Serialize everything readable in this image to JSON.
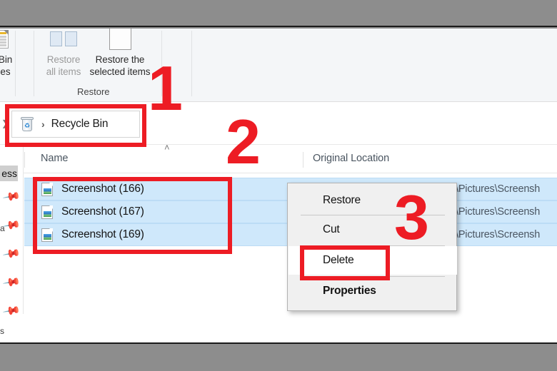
{
  "window": {
    "title": "Recycle Bin"
  },
  "ribbon": {
    "buttons": [
      {
        "name": "recycle-bin-properties",
        "line1": "e Bin",
        "line2": "rties",
        "state": "enabled"
      },
      {
        "name": "restore-all-items",
        "line1": "Restore",
        "line2": "all items",
        "state": "disabled"
      },
      {
        "name": "restore-selected-items",
        "line1": "Restore the",
        "line2": "selected items",
        "state": "enabled"
      }
    ],
    "group_title": "Restore"
  },
  "address_bar": {
    "icon": "recycle-bin-icon",
    "separator": "›",
    "path": "Recycle Bin"
  },
  "columns": [
    {
      "name": "name-column",
      "label": "Name",
      "sorted": true,
      "sort_arrow": "˄"
    },
    {
      "name": "original-location-column",
      "label": "Original Location"
    }
  ],
  "sidebar": {
    "quick_access_label": "ess",
    "fragments": [
      "a",
      "s"
    ],
    "pin_glyph": "📌",
    "pin_count": 5
  },
  "files": [
    {
      "name": "Screenshot (166)",
      "location": "\\Pictures\\Screensh",
      "selected": true
    },
    {
      "name": "Screenshot (167)",
      "location": "\\Pictures\\Screensh",
      "selected": true
    },
    {
      "name": "Screenshot (169)",
      "location": "\\Pictures\\Screensh",
      "selected": true
    }
  ],
  "context_menu": {
    "items": [
      {
        "name": "menu-item-restore",
        "label": "Restore",
        "hovered": false,
        "bold": false
      },
      {
        "name": "menu-item-cut",
        "label": "Cut",
        "hovered": false,
        "bold": false
      },
      {
        "name": "menu-item-delete",
        "label": "Delete",
        "hovered": true,
        "bold": false
      },
      {
        "name": "menu-item-properties",
        "label": "Properties",
        "hovered": false,
        "bold": true
      }
    ]
  },
  "annotations": {
    "color": "#ed1c24",
    "steps": [
      {
        "label": "1"
      },
      {
        "label": "2"
      },
      {
        "label": "3"
      }
    ]
  }
}
